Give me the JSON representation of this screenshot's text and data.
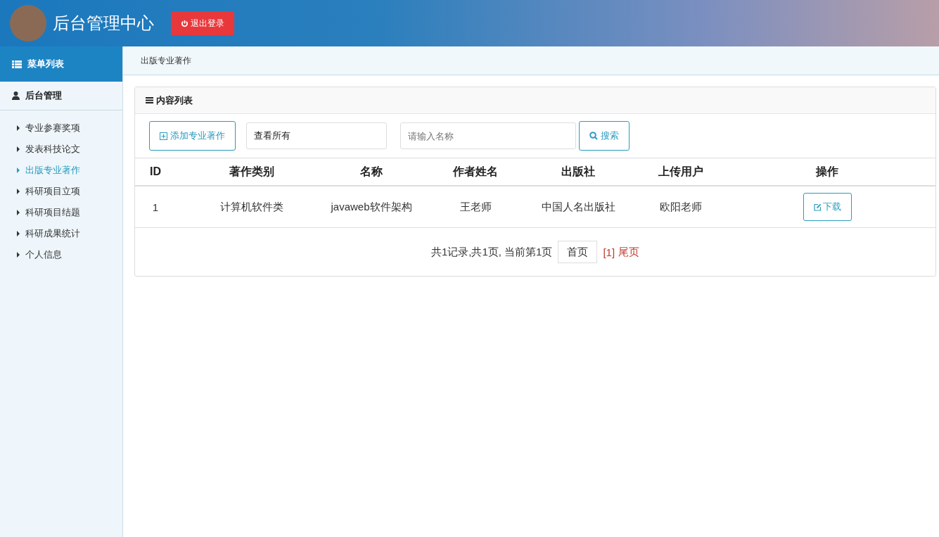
{
  "header": {
    "title": "后台管理中心",
    "logout_button": "退出登录"
  },
  "sidebar": {
    "heading": "菜单列表",
    "section": "后台管理",
    "items": [
      {
        "label": "专业参赛奖项",
        "selected": false
      },
      {
        "label": "发表科技论文",
        "selected": false
      },
      {
        "label": "出版专业著作",
        "selected": true
      },
      {
        "label": "科研项目立项",
        "selected": false
      },
      {
        "label": "科研项目结题",
        "selected": false
      },
      {
        "label": "科研成果统计",
        "selected": false
      },
      {
        "label": "个人信息",
        "selected": false
      }
    ]
  },
  "breadcrumb": "出版专业著作",
  "panel": {
    "title": "内容列表",
    "add_button": "添加专业著作",
    "filter": {
      "value": "查看所有"
    },
    "search": {
      "placeholder": "请输入名称"
    },
    "search_button": "搜索"
  },
  "table": {
    "columns": [
      "ID",
      "著作类别",
      "名称",
      "作者姓名",
      "出版社",
      "上传用户",
      "操作"
    ],
    "rows": [
      {
        "cells": [
          "1",
          "计算机软件类",
          "javaweb软件架构",
          "王老师",
          "中国人名出版社",
          "欧阳老师"
        ],
        "action": "下载"
      }
    ]
  },
  "pagination": {
    "summary": "共1记录,共1页, 当前第1页",
    "first": "首页",
    "current": "[1]",
    "last": "尾页"
  }
}
